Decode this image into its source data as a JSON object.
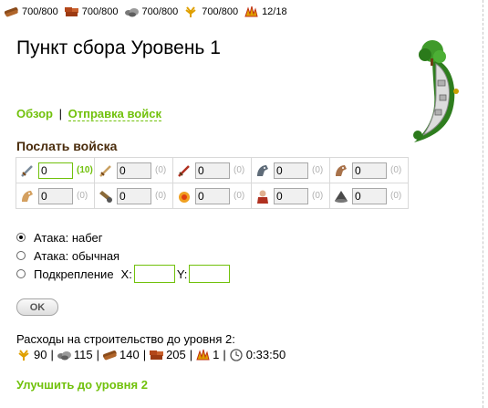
{
  "resources": [
    {
      "icon": "wood-icon",
      "value": "700/800"
    },
    {
      "icon": "clay-icon",
      "value": "700/800"
    },
    {
      "icon": "iron-icon",
      "value": "700/800"
    },
    {
      "icon": "crop-icon",
      "value": "700/800"
    },
    {
      "icon": "population-icon",
      "value": "12/18"
    }
  ],
  "page": {
    "title": "Пункт сбора Уровень 1"
  },
  "nav": {
    "overview": "Обзор",
    "separator": "|",
    "send_troops": "Отправка войск"
  },
  "send": {
    "heading": "Послать войска",
    "units": [
      {
        "icon": "unit-1-icon",
        "value": "0",
        "available": "(10)",
        "active": true
      },
      {
        "icon": "unit-2-icon",
        "value": "0",
        "available": "(0)",
        "active": false
      },
      {
        "icon": "unit-3-icon",
        "value": "0",
        "available": "(0)",
        "active": false
      },
      {
        "icon": "unit-4-icon",
        "value": "0",
        "available": "(0)",
        "active": false
      },
      {
        "icon": "unit-5-icon",
        "value": "0",
        "available": "(0)",
        "active": false
      },
      {
        "icon": "unit-6-icon",
        "value": "0",
        "available": "(0)",
        "active": false
      },
      {
        "icon": "unit-7-icon",
        "value": "0",
        "available": "(0)",
        "active": false
      },
      {
        "icon": "unit-8-icon",
        "value": "0",
        "available": "(0)",
        "active": false
      },
      {
        "icon": "unit-9-icon",
        "value": "0",
        "available": "(0)",
        "active": false
      },
      {
        "icon": "unit-10-icon",
        "value": "0",
        "available": "(0)",
        "active": false
      }
    ],
    "options": {
      "raid": "Атака: набег",
      "normal": "Атака: обычная",
      "reinforce": "Подкрепление",
      "selected": "raid"
    },
    "coords": {
      "x_label": "X:",
      "y_label": "Y:",
      "x": "",
      "y": ""
    },
    "ok_label": "OK"
  },
  "costs": {
    "heading": "Расходы на строительство до уровня 2:",
    "wood": "90",
    "iron": "115",
    "clay": "140",
    "crop": "205",
    "population": "1",
    "time": "0:33:50",
    "separator": "|"
  },
  "upgrade": {
    "label": "Улучшить до уровня 2"
  },
  "colors": {
    "accent": "#71c10c",
    "heading": "#4a2c0c",
    "border": "#d9d9d9"
  }
}
